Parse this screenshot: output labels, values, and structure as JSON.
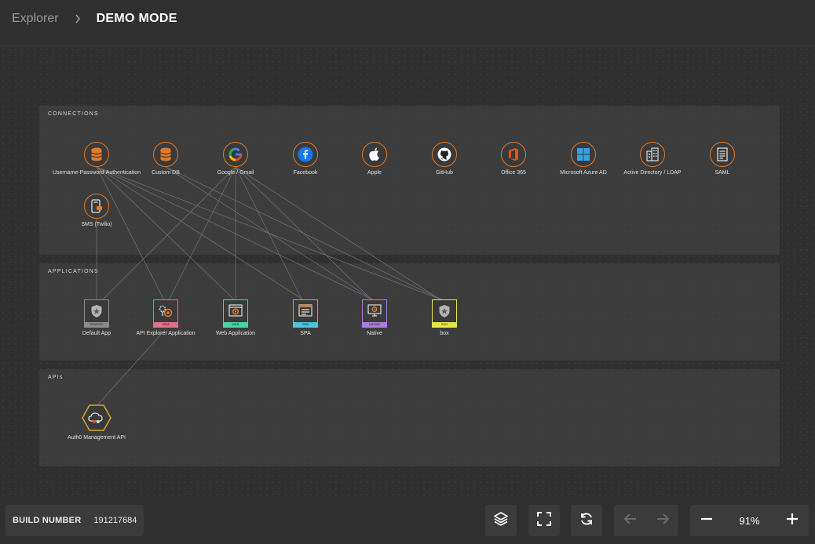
{
  "header": {
    "breadcrumb_root": "Explorer",
    "breadcrumb_current": "DEMO MODE"
  },
  "panels": {
    "connections_title": "CONNECTIONS",
    "applications_title": "APPLICATIONS",
    "apis_title": "APIs"
  },
  "connections": [
    {
      "label": "Username-Password-Authentication",
      "icon": "database-icon"
    },
    {
      "label": "Custom DB",
      "icon": "database-icon"
    },
    {
      "label": "Google / Gmail",
      "icon": "google-icon"
    },
    {
      "label": "Facebook",
      "icon": "facebook-icon"
    },
    {
      "label": "Apple",
      "icon": "apple-icon"
    },
    {
      "label": "GitHub",
      "icon": "github-icon"
    },
    {
      "label": "Office 365",
      "icon": "office-icon"
    },
    {
      "label": "Microsoft Azure AD",
      "icon": "windows-icon"
    },
    {
      "label": "Active Directory / LDAP",
      "icon": "building-icon"
    },
    {
      "label": "SAML",
      "icon": "document-icon"
    },
    {
      "label": "SMS (Twilio)",
      "icon": "phone-icon"
    }
  ],
  "applications": [
    {
      "label": "Default App",
      "tag": "GENERIC",
      "color": "#8c8c8c"
    },
    {
      "label": "API Explorer Application",
      "tag": "M2M",
      "color": "#e0708a"
    },
    {
      "label": "Web Application",
      "tag": "WEB",
      "color": "#4fd1a8"
    },
    {
      "label": "SPA",
      "tag": "SPA",
      "color": "#4cc3e0"
    },
    {
      "label": "Native",
      "tag": "NATIVE",
      "color": "#b07be0"
    },
    {
      "label": "box",
      "tag": "SSO",
      "color": "#e6e64a"
    }
  ],
  "apis": [
    {
      "label": "Auth0 Management API",
      "icon": "cloud-api-icon",
      "color": "#d6a92a"
    }
  ],
  "footer": {
    "build_label": "BUILD NUMBER",
    "build_value": "191217684",
    "zoom": "91%"
  },
  "colors": {
    "connection_ring": "#e07b2b",
    "link": "#6e6e6e"
  }
}
